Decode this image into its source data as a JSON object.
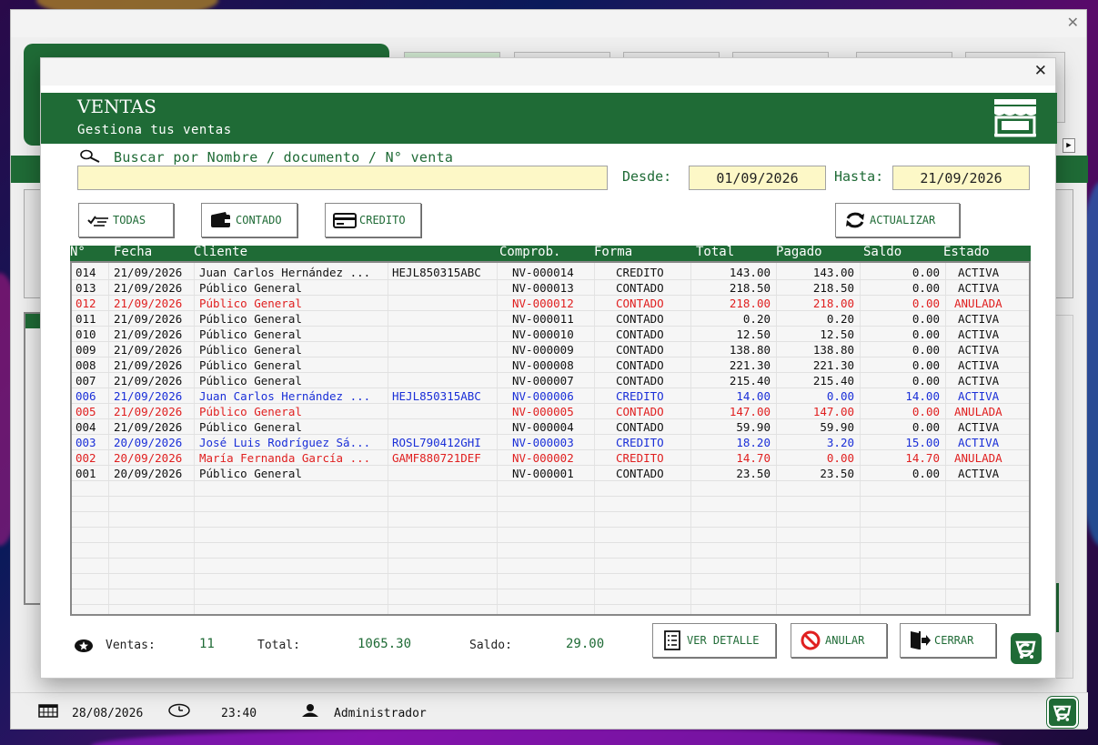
{
  "dialog": {
    "title": "VENTAS",
    "subtitle": "Gestiona tus ventas",
    "close": "✕"
  },
  "main_window": {
    "close": "✕"
  },
  "search": {
    "label": "Buscar por Nombre / documento / N° venta",
    "value": ""
  },
  "dates": {
    "from_label": "Desde:",
    "from_value": "01/09/2026",
    "to_label": "Hasta:",
    "to_value": "21/09/2026"
  },
  "filters": {
    "todas": "TODAS",
    "contado": "CONTADO",
    "credito": "CREDITO",
    "actualizar": "ACTUALIZAR"
  },
  "columns": {
    "num": "N°",
    "fecha": "Fecha",
    "cliente": "Cliente",
    "comprob": "Comprob.",
    "forma": "Forma",
    "total": "Total",
    "pagado": "Pagado",
    "saldo": "Saldo",
    "estado": "Estado"
  },
  "rows": [
    {
      "num": "014",
      "fecha": "21/09/2026",
      "cliente": "Juan Carlos Hernández ...",
      "doc": "HEJL850315ABC",
      "comprob": "NV-000014",
      "forma": "CREDITO",
      "total": "143.00",
      "pagado": "143.00",
      "saldo": "0.00",
      "estado": "ACTIVA",
      "color": "black"
    },
    {
      "num": "013",
      "fecha": "21/09/2026",
      "cliente": "Público General",
      "doc": "",
      "comprob": "NV-000013",
      "forma": "CONTADO",
      "total": "218.50",
      "pagado": "218.50",
      "saldo": "0.00",
      "estado": "ACTIVA",
      "color": "black"
    },
    {
      "num": "012",
      "fecha": "21/09/2026",
      "cliente": "Público General",
      "doc": "",
      "comprob": "NV-000012",
      "forma": "CONTADO",
      "total": "218.00",
      "pagado": "218.00",
      "saldo": "0.00",
      "estado": "ANULADA",
      "color": "red"
    },
    {
      "num": "011",
      "fecha": "21/09/2026",
      "cliente": "Público General",
      "doc": "",
      "comprob": "NV-000011",
      "forma": "CONTADO",
      "total": "0.20",
      "pagado": "0.20",
      "saldo": "0.00",
      "estado": "ACTIVA",
      "color": "black"
    },
    {
      "num": "010",
      "fecha": "21/09/2026",
      "cliente": "Público General",
      "doc": "",
      "comprob": "NV-000010",
      "forma": "CONTADO",
      "total": "12.50",
      "pagado": "12.50",
      "saldo": "0.00",
      "estado": "ACTIVA",
      "color": "black"
    },
    {
      "num": "009",
      "fecha": "21/09/2026",
      "cliente": "Público General",
      "doc": "",
      "comprob": "NV-000009",
      "forma": "CONTADO",
      "total": "138.80",
      "pagado": "138.80",
      "saldo": "0.00",
      "estado": "ACTIVA",
      "color": "black"
    },
    {
      "num": "008",
      "fecha": "21/09/2026",
      "cliente": "Público General",
      "doc": "",
      "comprob": "NV-000008",
      "forma": "CONTADO",
      "total": "221.30",
      "pagado": "221.30",
      "saldo": "0.00",
      "estado": "ACTIVA",
      "color": "black"
    },
    {
      "num": "007",
      "fecha": "21/09/2026",
      "cliente": "Público General",
      "doc": "",
      "comprob": "NV-000007",
      "forma": "CONTADO",
      "total": "215.40",
      "pagado": "215.40",
      "saldo": "0.00",
      "estado": "ACTIVA",
      "color": "black"
    },
    {
      "num": "006",
      "fecha": "21/09/2026",
      "cliente": "Juan Carlos Hernández ...",
      "doc": "HEJL850315ABC",
      "comprob": "NV-000006",
      "forma": "CREDITO",
      "total": "14.00",
      "pagado": "0.00",
      "saldo": "14.00",
      "estado": "ACTIVA",
      "color": "blue"
    },
    {
      "num": "005",
      "fecha": "21/09/2026",
      "cliente": "Público General",
      "doc": "",
      "comprob": "NV-000005",
      "forma": "CONTADO",
      "total": "147.00",
      "pagado": "147.00",
      "saldo": "0.00",
      "estado": "ANULADA",
      "color": "red"
    },
    {
      "num": "004",
      "fecha": "21/09/2026",
      "cliente": "Público General",
      "doc": "",
      "comprob": "NV-000004",
      "forma": "CONTADO",
      "total": "59.90",
      "pagado": "59.90",
      "saldo": "0.00",
      "estado": "ACTIVA",
      "color": "black"
    },
    {
      "num": "003",
      "fecha": "20/09/2026",
      "cliente": "José Luis Rodríguez Sá...",
      "doc": "ROSL790412GHI",
      "comprob": "NV-000003",
      "forma": "CREDITO",
      "total": "18.20",
      "pagado": "3.20",
      "saldo": "15.00",
      "estado": "ACTIVA",
      "color": "blue"
    },
    {
      "num": "002",
      "fecha": "20/09/2026",
      "cliente": "María Fernanda García ...",
      "doc": "GAMF880721DEF",
      "comprob": "NV-000002",
      "forma": "CREDITO",
      "total": "14.70",
      "pagado": "0.00",
      "saldo": "14.70",
      "estado": "ANULADA",
      "color": "red"
    },
    {
      "num": "001",
      "fecha": "20/09/2026",
      "cliente": "Público General",
      "doc": "",
      "comprob": "NV-000001",
      "forma": "CONTADO",
      "total": "23.50",
      "pagado": "23.50",
      "saldo": "0.00",
      "estado": "ACTIVA",
      "color": "black"
    }
  ],
  "summary": {
    "ventas_label": "Ventas:",
    "ventas_value": "11",
    "total_label": "Total:",
    "total_value": "1065.30",
    "saldo_label": "Saldo:",
    "saldo_value": "29.00"
  },
  "actions": {
    "ver_detalle": "VER DETALLE",
    "anular": "ANULAR",
    "cerrar": "CERRAR"
  },
  "statusbar": {
    "date": "28/08/2026",
    "time": "23:40",
    "user": "Administrador"
  },
  "colors": {
    "accent": "#1f6b36",
    "input_bg": "#fdf8c7",
    "row_red": "#e02020",
    "row_blue": "#1a2fd8"
  }
}
